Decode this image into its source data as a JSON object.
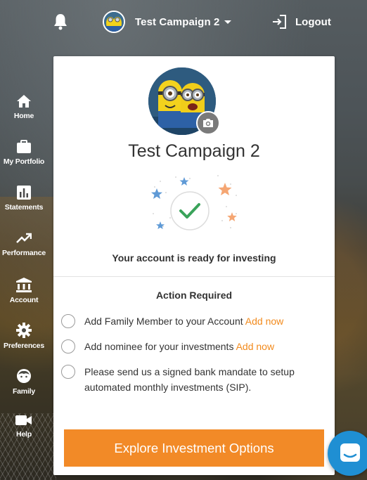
{
  "topbar": {
    "campaign_name": "Test Campaign 2",
    "logout_label": "Logout"
  },
  "sidebar": {
    "items": [
      {
        "label": "Home",
        "icon": "home-icon"
      },
      {
        "label": "My Portfolio",
        "icon": "briefcase-icon"
      },
      {
        "label": "Statements",
        "icon": "bar-chart-icon"
      },
      {
        "label": "Performance",
        "icon": "trending-up-icon"
      },
      {
        "label": "Account",
        "icon": "bank-icon"
      },
      {
        "label": "Preferences",
        "icon": "gear-icon"
      },
      {
        "label": "Family",
        "icon": "face-icon"
      },
      {
        "label": "Help",
        "icon": "video-camera-icon"
      }
    ]
  },
  "card": {
    "title": "Test Campaign 2",
    "status_message": "Your account is ready for investing",
    "action_required_title": "Action Required",
    "actions": [
      {
        "text": "Add Family Member to your Account",
        "link": "Add now"
      },
      {
        "text": "Add nominee for your investments",
        "link": "Add now"
      },
      {
        "text": "Please send us a signed bank mandate to setup automated monthly investments (SIP).",
        "link": ""
      }
    ],
    "cta_label": "Explore Investment Options"
  },
  "colors": {
    "accent": "#f28a27",
    "link": "#f28a1c",
    "success": "#3aa35a",
    "chat": "#1f8fd3"
  }
}
